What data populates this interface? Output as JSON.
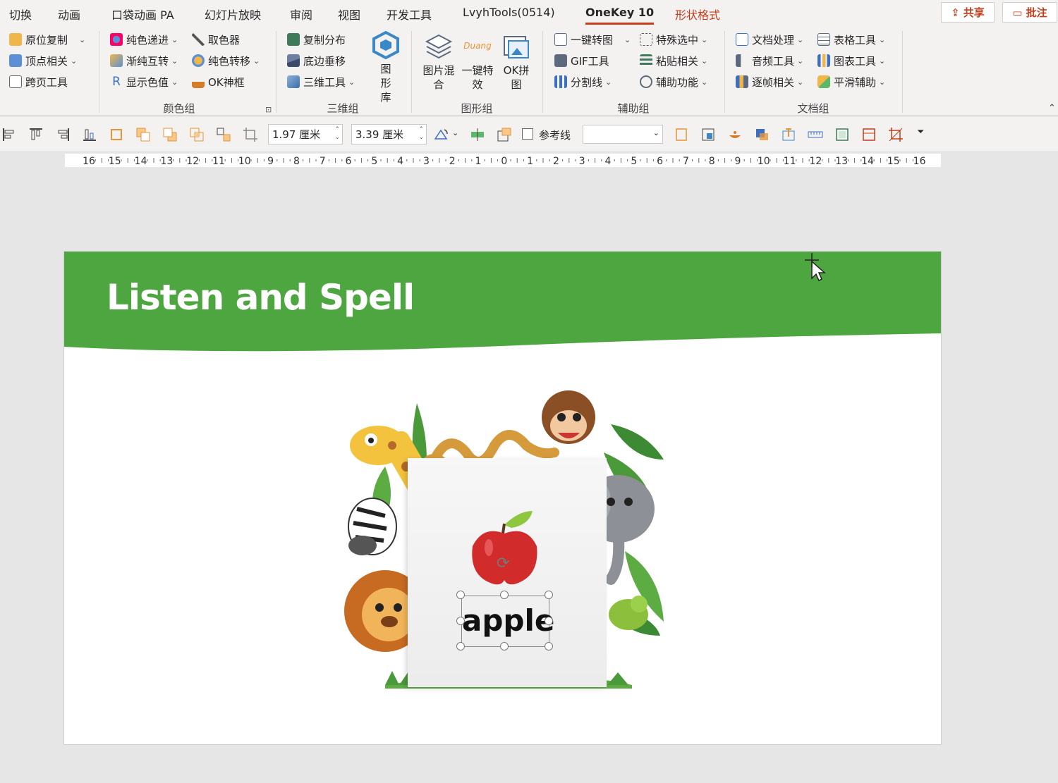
{
  "tabs": [
    {
      "label": "切换"
    },
    {
      "label": "动画"
    },
    {
      "label": "口袋动画 PA"
    },
    {
      "label": "幻灯片放映"
    },
    {
      "label": "审阅"
    },
    {
      "label": "视图"
    },
    {
      "label": "开发工具"
    },
    {
      "label": "LvyhTools(0514)"
    },
    {
      "label": "OneKey 10"
    },
    {
      "label": "形状格式"
    }
  ],
  "top_buttons": {
    "share": "共享",
    "comment": "批注"
  },
  "ribbon": {
    "color_group": {
      "label": "颜色组",
      "items": [
        "原位复制",
        "顶点相关",
        "跨页工具",
        "纯色递进",
        "渐纯互转",
        "显示色值",
        "取色器",
        "纯色转移",
        "OK神框"
      ],
      "display_color_prefix": "R"
    },
    "three_d_group": {
      "label": "三维组",
      "items": [
        "复制分布",
        "底边垂移",
        "三维工具"
      ],
      "big": "图形库"
    },
    "shape_group": {
      "label": "图形组",
      "big_items": [
        "图片混合",
        "一键特效",
        "OK拼图"
      ],
      "duang": "Duang"
    },
    "aux_group": {
      "label": "辅助组",
      "items": [
        "一键转图",
        "GIF工具",
        "分割线",
        "特殊选中",
        "粘贴相关",
        "辅助功能"
      ]
    },
    "doc_group": {
      "label": "文档组",
      "items": [
        "文档处理",
        "音频工具",
        "逐帧相关",
        "表格工具",
        "图表工具",
        "平滑辅助"
      ]
    }
  },
  "toolbar": {
    "height_value": "1.97 厘米",
    "width_value": "3.39 厘米",
    "guide_label": "参考线"
  },
  "ruler": {
    "labels": [
      "16",
      "15",
      "14",
      "13",
      "12",
      "11",
      "10",
      "9",
      "8",
      "7",
      "6",
      "5",
      "4",
      "3",
      "2",
      "1",
      "0",
      "1",
      "2",
      "3",
      "4",
      "5",
      "6",
      "7",
      "8",
      "9",
      "10",
      "11",
      "12",
      "13",
      "14",
      "15",
      "16"
    ]
  },
  "slide": {
    "title": "Listen and Spell",
    "word": "apple",
    "header_color": "#4ea640"
  }
}
